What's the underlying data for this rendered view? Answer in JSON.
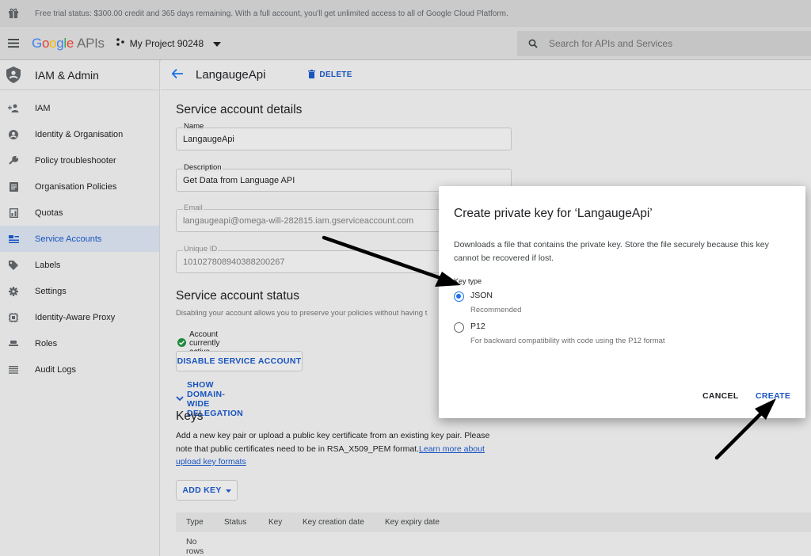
{
  "trial_banner": {
    "text": "Free trial status: $300.00 credit and 365 days remaining. With a full account, you'll get unlimited access to all of Google Cloud Platform."
  },
  "header": {
    "logo_google": "Google",
    "logo_apis": "APIs",
    "project": "My Project 90248",
    "search_placeholder": "Search for APIs and Services"
  },
  "sidebar": {
    "title": "IAM & Admin",
    "items": [
      {
        "label": "IAM",
        "icon": "person-add-icon"
      },
      {
        "label": "Identity & Organisation",
        "icon": "account-circle-icon"
      },
      {
        "label": "Policy troubleshooter",
        "icon": "wrench-icon"
      },
      {
        "label": "Organisation Policies",
        "icon": "document-icon"
      },
      {
        "label": "Quotas",
        "icon": "quota-icon"
      },
      {
        "label": "Service Accounts",
        "icon": "service-account-icon",
        "active": true
      },
      {
        "label": "Labels",
        "icon": "label-icon"
      },
      {
        "label": "Settings",
        "icon": "gear-icon"
      },
      {
        "label": "Identity-Aware Proxy",
        "icon": "proxy-icon"
      },
      {
        "label": "Roles",
        "icon": "roles-icon"
      },
      {
        "label": "Audit Logs",
        "icon": "list-icon"
      }
    ]
  },
  "page": {
    "title": "LangaugeApi",
    "delete_label": "DELETE",
    "details_heading": "Service account details",
    "name_label": "Name",
    "name_value": "LangaugeApi",
    "description_label": "Description",
    "description_value": "Get Data from Language API",
    "email_label": "Email",
    "email_value": "langaugeapi@omega-will-282815.iam.gserviceaccount.com",
    "unique_id_label": "Unique ID",
    "unique_id_value": "101027808940388200267",
    "status_heading": "Service account status",
    "status_desc": "Disabling your account allows you to preserve your policies without having t",
    "status_active": "Account currently active",
    "disable_button": "DISABLE SERVICE ACCOUNT",
    "domain_delegation": "SHOW DOMAIN-WIDE DELEGATION",
    "keys_heading": "Keys",
    "keys_text": "Add a new key pair or upload a public key certificate from an existing key pair. Please note that public certificates need to be in RSA_X509_PEM format.",
    "keys_link": "Learn more about upload key formats",
    "add_key": "ADD KEY",
    "table_columns": [
      "Type",
      "Status",
      "Key",
      "Key creation date",
      "Key expiry date"
    ],
    "table_empty": "No rows to display"
  },
  "dialog": {
    "title": "Create private key for ‘LangaugeApi’",
    "description": "Downloads a file that contains the private key. Store the file securely because this key cannot be recovered if lost.",
    "key_type_label": "Key type",
    "options": [
      {
        "label": "JSON",
        "sublabel": "Recommended",
        "selected": true
      },
      {
        "label": "P12",
        "sublabel": "For backward compatibility with code using the P12 format",
        "selected": false
      }
    ],
    "cancel": "CANCEL",
    "create": "CREATE"
  },
  "colors": {
    "accent": "#1a73e8",
    "link": "#1a56c4",
    "success": "#1e8e3e"
  }
}
